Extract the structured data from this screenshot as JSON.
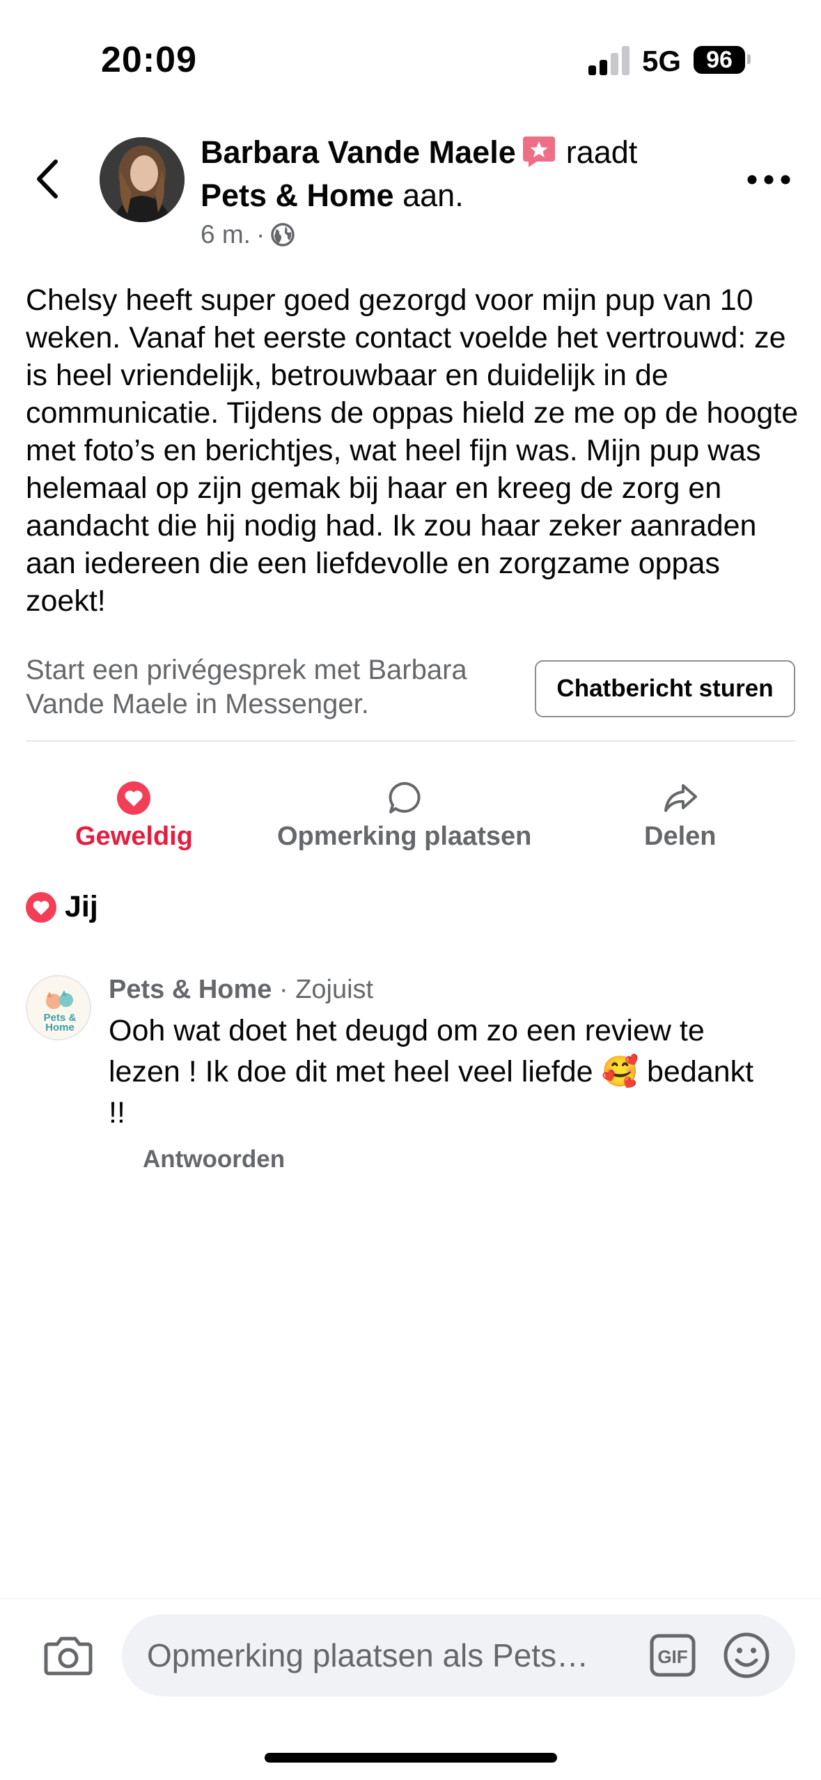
{
  "status_bar": {
    "time": "20:09",
    "network": "5G",
    "battery": "96"
  },
  "post": {
    "author": "Barbara Vande Maele",
    "verb": "raadt",
    "page_name": "Pets & Home",
    "suffix": "aan.",
    "time": "6 m.",
    "separator": "·",
    "text": "Chelsy heeft super goed gezorgd voor mijn pup van 10 weken. Vanaf het eerste contact voelde het vertrouwd: ze is heel vriendelijk, betrouwbaar en duidelijk in de communicatie. Tijdens de oppas hield ze me op de hoogte met foto’s en berichtjes, wat heel fijn was. Mijn pup was helemaal op zijn gemak bij haar en kreeg de zorg en aandacht die hij nodig had. Ik zou haar zeker aanraden aan iedereen die een liefdevolle en zorgzame oppas zoekt!"
  },
  "messenger": {
    "prompt": "Start een privégesprek met Barbara Vande Maele in Messenger.",
    "button_label": "Chatbericht sturen"
  },
  "actions": {
    "love_label": "Geweldig",
    "comment_label": "Opmerking plaatsen",
    "share_label": "Delen"
  },
  "reactions": {
    "label": "Jij"
  },
  "comment": {
    "avatar_text_1": "Pets &",
    "avatar_text_2": "Home",
    "author": "Pets & Home",
    "separator": " · ",
    "time": "Zojuist",
    "text": "Ooh wat doet het deugd om zo een review te lezen ! Ik doe dit met heel veel liefde 🥰 bedankt !!",
    "reply_label": "Antwoorden"
  },
  "composer": {
    "placeholder": "Opmerking plaatsen als Pets…",
    "gif_label": "GIF"
  },
  "colors": {
    "love": "#e41e3f",
    "secondary_text": "#65676b",
    "primary_text": "#050505",
    "field_bg": "#f0f2f5"
  },
  "icons": {
    "back": "chevron-left-icon",
    "more": "more-dots-icon",
    "globe": "globe-icon",
    "recommend": "recommend-badge-icon",
    "love": "heart-icon",
    "comment": "comment-bubble-icon",
    "share": "share-arrow-icon",
    "camera": "camera-icon",
    "gif": "gif-icon",
    "emoji": "emoji-icon"
  }
}
